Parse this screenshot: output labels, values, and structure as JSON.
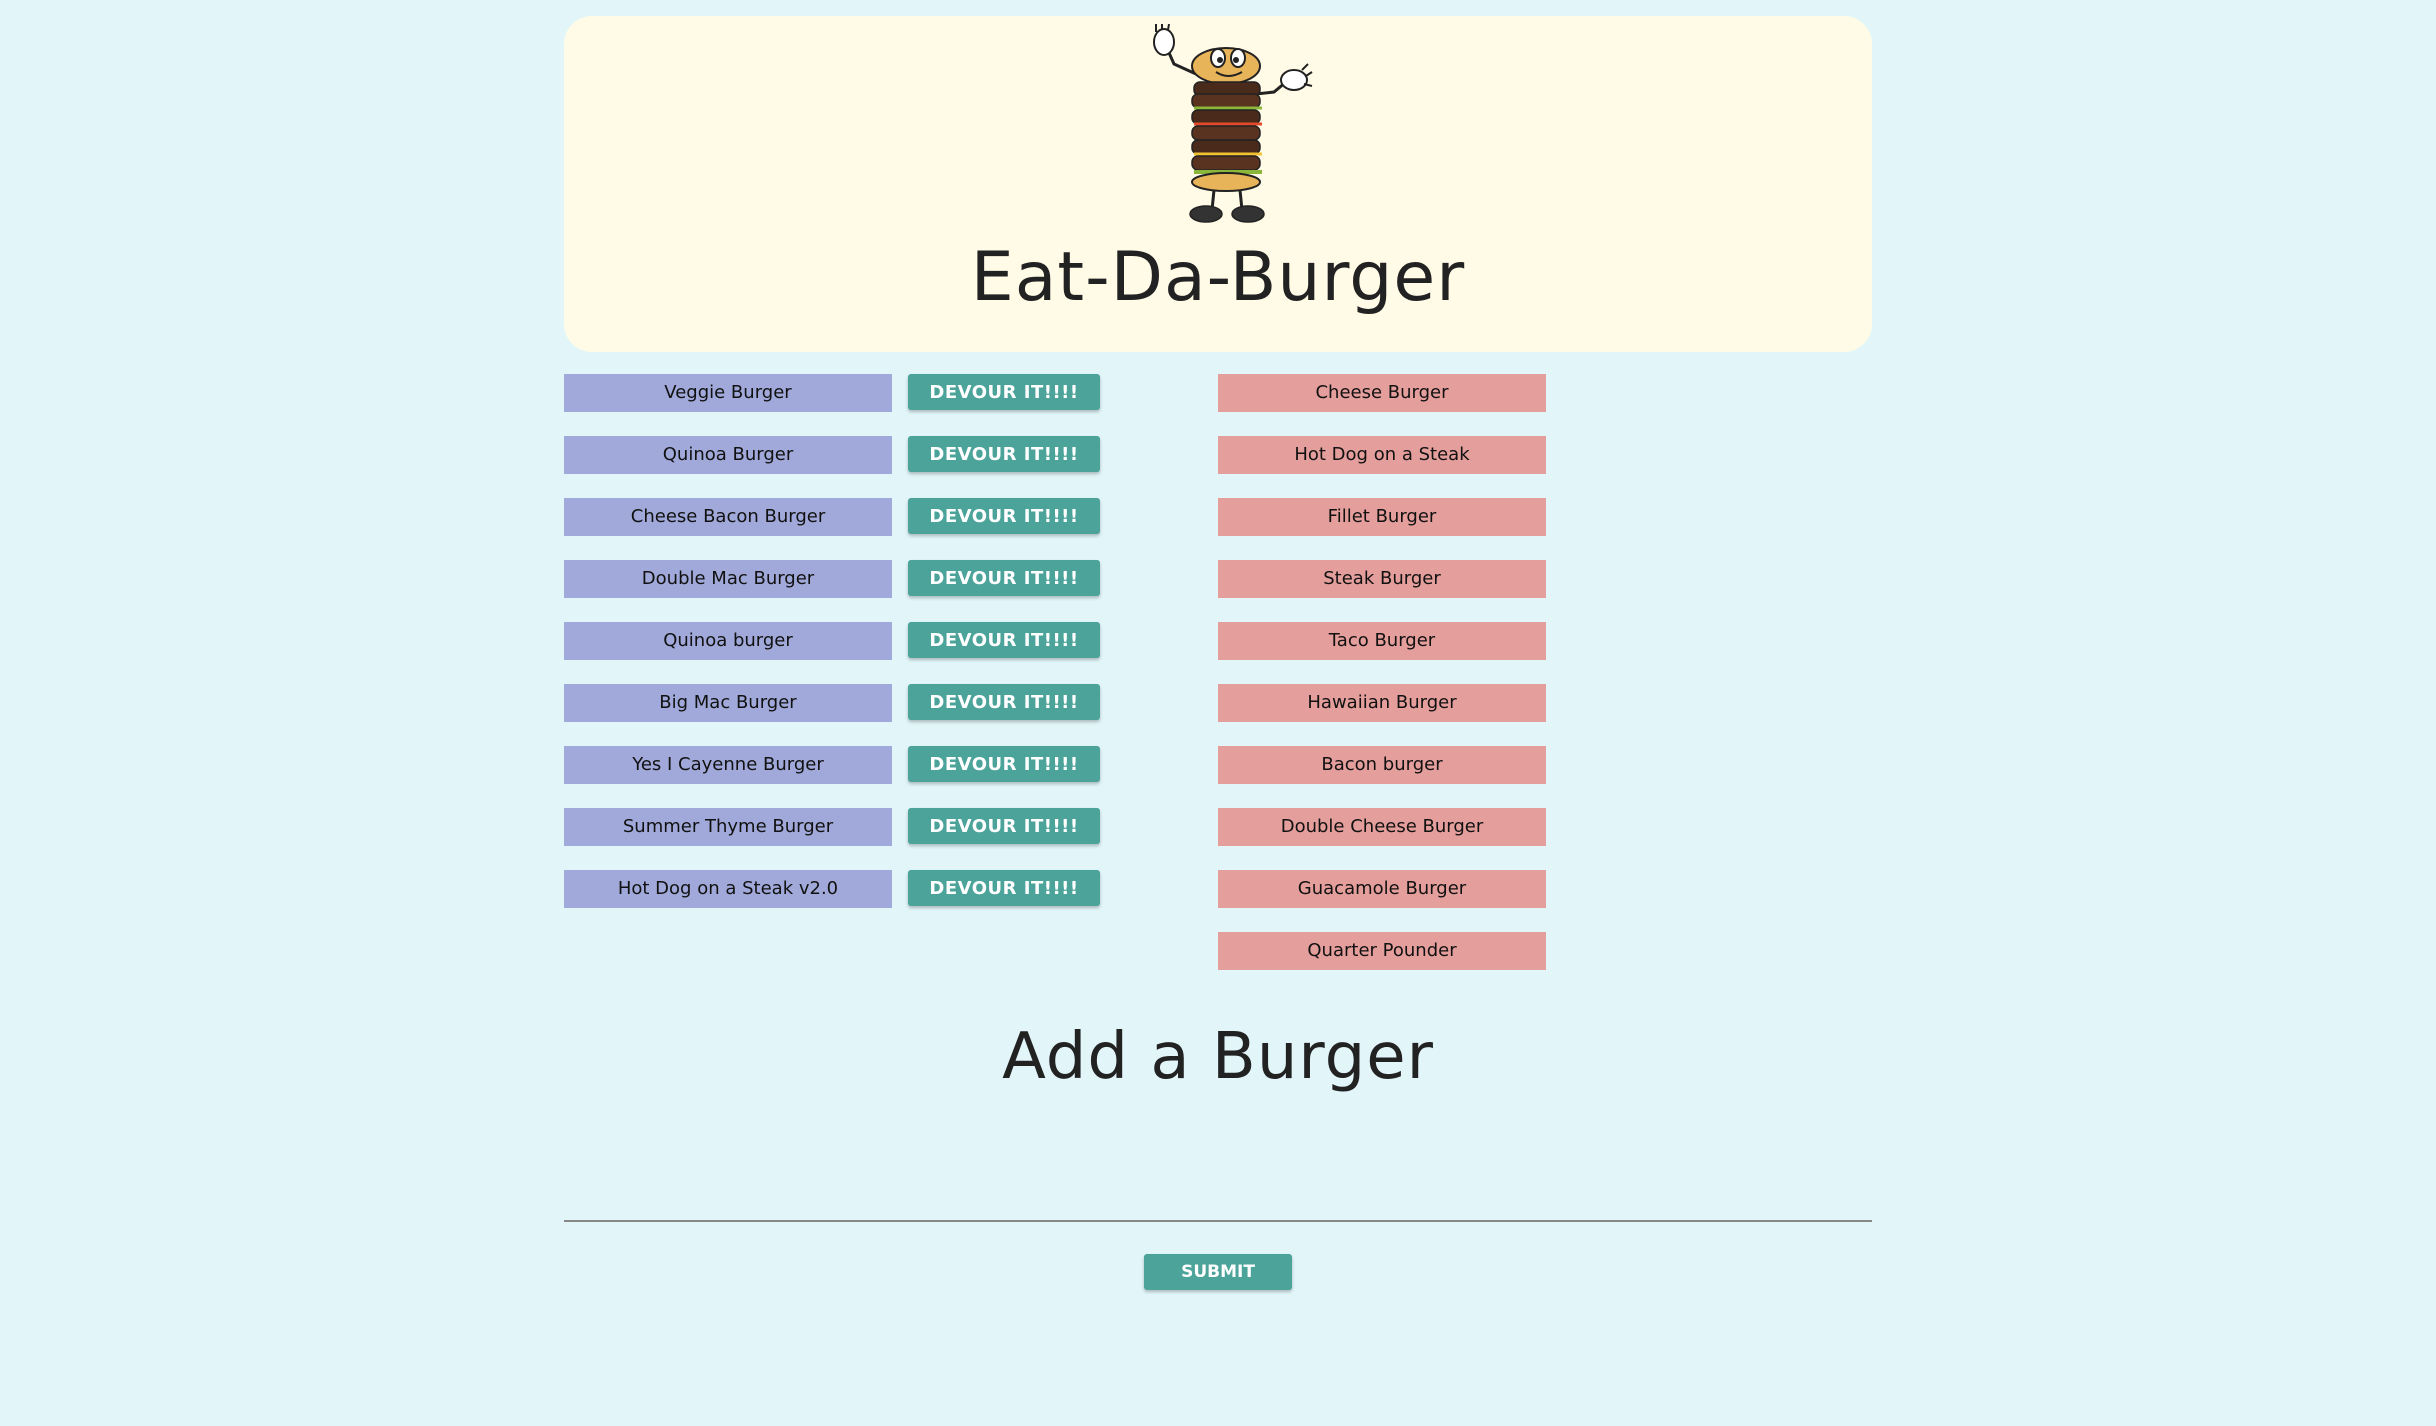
{
  "header": {
    "title": "Eat-Da-Burger",
    "mascot_icon": "burger-mascot-icon"
  },
  "uneaten_burgers": [
    {
      "name": "Veggie Burger",
      "button_label": "DEVOUR IT!!!!"
    },
    {
      "name": "Quinoa Burger",
      "button_label": "DEVOUR IT!!!!"
    },
    {
      "name": "Cheese Bacon Burger",
      "button_label": "DEVOUR IT!!!!"
    },
    {
      "name": "Double Mac Burger",
      "button_label": "DEVOUR IT!!!!"
    },
    {
      "name": "Quinoa burger",
      "button_label": "DEVOUR IT!!!!"
    },
    {
      "name": "Big Mac Burger",
      "button_label": "DEVOUR IT!!!!"
    },
    {
      "name": "Yes I Cayenne Burger",
      "button_label": "DEVOUR IT!!!!"
    },
    {
      "name": "Summer Thyme Burger",
      "button_label": "DEVOUR IT!!!!"
    },
    {
      "name": "Hot Dog on a Steak v2.0",
      "button_label": "DEVOUR IT!!!!"
    }
  ],
  "devoured_burgers": [
    "Cheese Burger",
    "Hot Dog on a Steak",
    "Fillet Burger",
    "Steak Burger",
    "Taco Burger",
    "Hawaiian Burger",
    "Bacon burger",
    "Double Cheese Burger",
    "Guacamole Burger",
    "Quarter Pounder"
  ],
  "add_form": {
    "title": "Add a Burger",
    "input_value": "",
    "submit_label": "SUBMIT"
  },
  "colors": {
    "page_background": "#e2f6fa",
    "header_background": "#fffbe7",
    "uneaten_item": "#a0a9d9",
    "devoured_item": "#e49e9c",
    "button": "#4ba39a"
  }
}
